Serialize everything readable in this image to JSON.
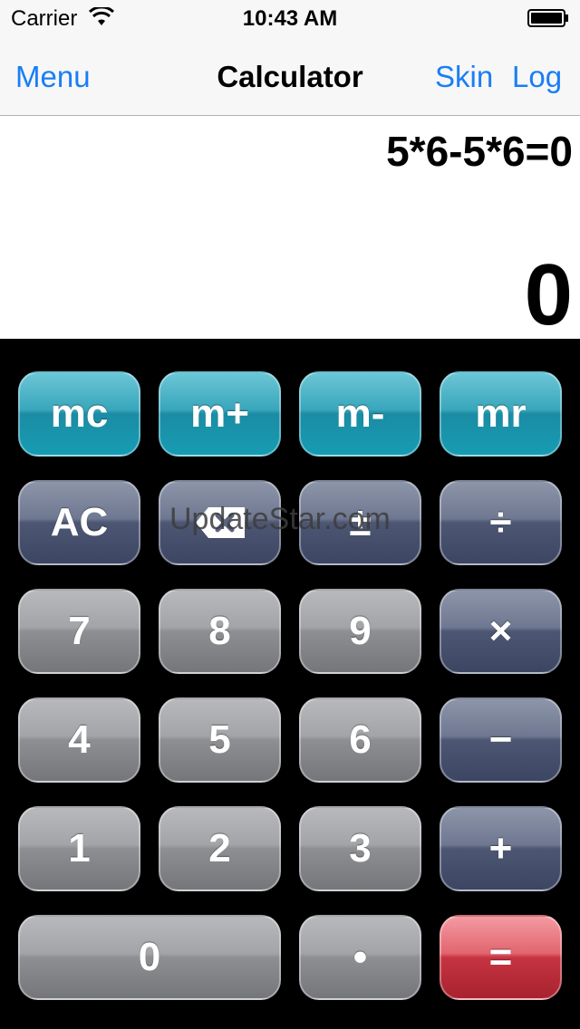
{
  "status_bar": {
    "carrier": "Carrier",
    "time": "10:43 AM"
  },
  "nav_bar": {
    "menu_label": "Menu",
    "title": "Calculator",
    "skin_label": "Skin",
    "log_label": "Log"
  },
  "display": {
    "expression": "5*6-5*6=0",
    "result": "0"
  },
  "keypad": {
    "mc": "mc",
    "m_plus": "m+",
    "m_minus": "m-",
    "mr": "mr",
    "ac": "AC",
    "plus_minus": "±",
    "divide": "÷",
    "seven": "7",
    "eight": "8",
    "nine": "9",
    "multiply": "×",
    "four": "4",
    "five": "5",
    "six": "6",
    "minus": "−",
    "one": "1",
    "two": "2",
    "three": "3",
    "plus": "+",
    "zero": "0",
    "decimal": "•",
    "equals": "="
  },
  "watermark": "UpdateStar.com",
  "colors": {
    "accent": "#1a7ef5",
    "memory_key": "#1b8ca4",
    "operator_key": "#4d5672",
    "digit_key": "#8e8f93",
    "equals_key": "#c63441"
  }
}
